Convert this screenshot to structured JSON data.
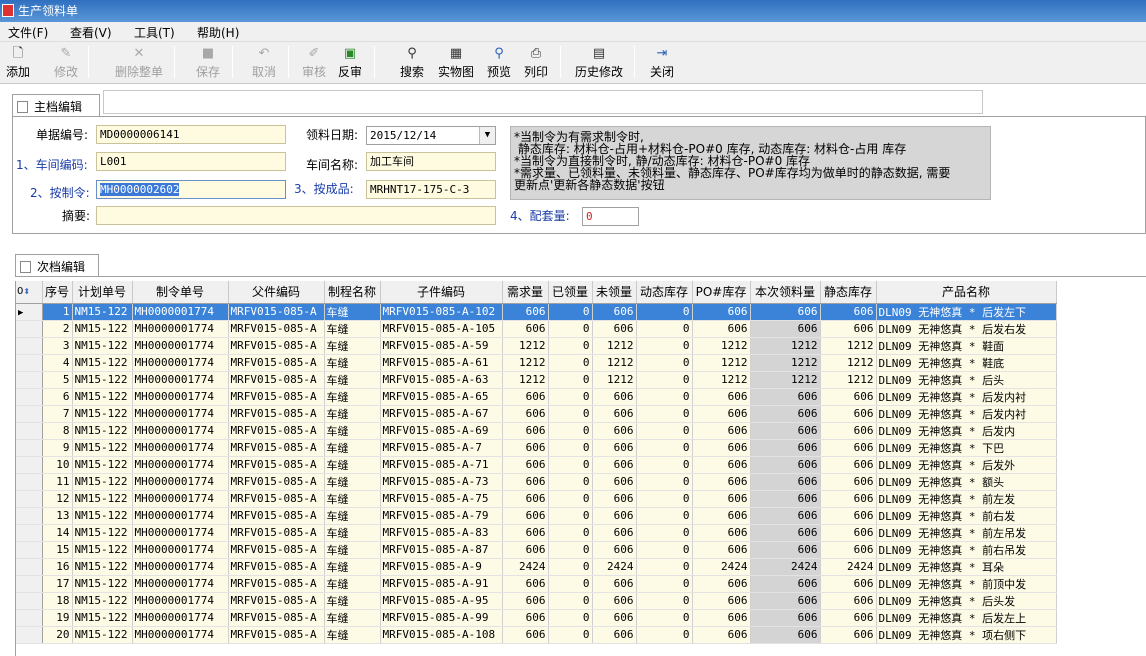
{
  "window": {
    "title": "生产领料单"
  },
  "menu": {
    "file": "文件(F)",
    "view": "查看(V)",
    "tools": "工具(T)",
    "help": "帮助(H)"
  },
  "toolbar": {
    "add": "添加",
    "edit": "修改",
    "delete_all": "删除整单",
    "save": "保存",
    "cancel": "取消",
    "audit": "审核",
    "reverse_audit": "反审",
    "search": "搜索",
    "physical_view": "实物图",
    "preview": "预览",
    "print": "列印",
    "history_edit": "历史修改",
    "close": "关闭"
  },
  "master": {
    "tab": "主档编辑",
    "doc_no_label": "单据编号:",
    "doc_no": "MD0000006141",
    "date_label": "领料日期:",
    "date": "2015/12/14",
    "workshop_code_label": "1、车间编码:",
    "workshop_code": "L001",
    "workshop_name_label": "车间名称:",
    "workshop_name": "加工车间",
    "order_label": "2、按制令:",
    "order": "MH0000002602",
    "product_label": "3、按成品:",
    "product": "MRHNT17-175-C-3",
    "remark_label": "摘要:",
    "remark": "",
    "sets_label": "4、配套量:",
    "sets": "0",
    "note": "*当制令为有需求制令时,\n 静态库存: 材料仓-占用+材料仓-PO#0 库存, 动态库存: 材料仓-占用 库存\n*当制令为直接制令时, 静/动态库存: 材料仓-PO#0 库存\n*需求量、已领料量、未领料量、静态库存、PO#库存均为做单时的静态数据, 需要\n更新点'更新各静态数据'按钮"
  },
  "detail": {
    "tab": "次档编辑",
    "corner": "0",
    "columns": [
      "序号",
      "计划单号",
      "制令单号",
      "父件编码",
      "制程名称",
      "子件编码",
      "需求量",
      "已领量",
      "未领量",
      "动态库存",
      "PO#库存",
      "本次领料量",
      "静态库存",
      "产品名称"
    ],
    "rows": [
      [
        "1",
        "NM15-122",
        "MH0000001774",
        "MRFV015-085-A",
        "车缝",
        "MRFV015-085-A-102",
        "606",
        "0",
        "606",
        "0",
        "606",
        "606",
        "606",
        "DLN09 无神悠真  * 后发左下"
      ],
      [
        "2",
        "NM15-122",
        "MH0000001774",
        "MRFV015-085-A",
        "车缝",
        "MRFV015-085-A-105",
        "606",
        "0",
        "606",
        "0",
        "606",
        "606",
        "606",
        "DLN09 无神悠真  * 后发右发"
      ],
      [
        "3",
        "NM15-122",
        "MH0000001774",
        "MRFV015-085-A",
        "车缝",
        "MRFV015-085-A-59",
        "1212",
        "0",
        "1212",
        "0",
        "1212",
        "1212",
        "1212",
        "DLN09 无神悠真  * 鞋面"
      ],
      [
        "4",
        "NM15-122",
        "MH0000001774",
        "MRFV015-085-A",
        "车缝",
        "MRFV015-085-A-61",
        "1212",
        "0",
        "1212",
        "0",
        "1212",
        "1212",
        "1212",
        "DLN09 无神悠真  * 鞋底"
      ],
      [
        "5",
        "NM15-122",
        "MH0000001774",
        "MRFV015-085-A",
        "车缝",
        "MRFV015-085-A-63",
        "1212",
        "0",
        "1212",
        "0",
        "1212",
        "1212",
        "1212",
        "DLN09 无神悠真  * 后头"
      ],
      [
        "6",
        "NM15-122",
        "MH0000001774",
        "MRFV015-085-A",
        "车缝",
        "MRFV015-085-A-65",
        "606",
        "0",
        "606",
        "0",
        "606",
        "606",
        "606",
        "DLN09 无神悠真  * 后发内衬"
      ],
      [
        "7",
        "NM15-122",
        "MH0000001774",
        "MRFV015-085-A",
        "车缝",
        "MRFV015-085-A-67",
        "606",
        "0",
        "606",
        "0",
        "606",
        "606",
        "606",
        "DLN09 无神悠真  * 后发内衬"
      ],
      [
        "8",
        "NM15-122",
        "MH0000001774",
        "MRFV015-085-A",
        "车缝",
        "MRFV015-085-A-69",
        "606",
        "0",
        "606",
        "0",
        "606",
        "606",
        "606",
        "DLN09 无神悠真  * 后发内"
      ],
      [
        "9",
        "NM15-122",
        "MH0000001774",
        "MRFV015-085-A",
        "车缝",
        "MRFV015-085-A-7",
        "606",
        "0",
        "606",
        "0",
        "606",
        "606",
        "606",
        "DLN09 无神悠真  * 下巴"
      ],
      [
        "10",
        "NM15-122",
        "MH0000001774",
        "MRFV015-085-A",
        "车缝",
        "MRFV015-085-A-71",
        "606",
        "0",
        "606",
        "0",
        "606",
        "606",
        "606",
        "DLN09 无神悠真  * 后发外"
      ],
      [
        "11",
        "NM15-122",
        "MH0000001774",
        "MRFV015-085-A",
        "车缝",
        "MRFV015-085-A-73",
        "606",
        "0",
        "606",
        "0",
        "606",
        "606",
        "606",
        "DLN09 无神悠真  * 额头"
      ],
      [
        "12",
        "NM15-122",
        "MH0000001774",
        "MRFV015-085-A",
        "车缝",
        "MRFV015-085-A-75",
        "606",
        "0",
        "606",
        "0",
        "606",
        "606",
        "606",
        "DLN09 无神悠真  * 前左发"
      ],
      [
        "13",
        "NM15-122",
        "MH0000001774",
        "MRFV015-085-A",
        "车缝",
        "MRFV015-085-A-79",
        "606",
        "0",
        "606",
        "0",
        "606",
        "606",
        "606",
        "DLN09 无神悠真  * 前右发"
      ],
      [
        "14",
        "NM15-122",
        "MH0000001774",
        "MRFV015-085-A",
        "车缝",
        "MRFV015-085-A-83",
        "606",
        "0",
        "606",
        "0",
        "606",
        "606",
        "606",
        "DLN09 无神悠真  * 前左吊发"
      ],
      [
        "15",
        "NM15-122",
        "MH0000001774",
        "MRFV015-085-A",
        "车缝",
        "MRFV015-085-A-87",
        "606",
        "0",
        "606",
        "0",
        "606",
        "606",
        "606",
        "DLN09 无神悠真  * 前右吊发"
      ],
      [
        "16",
        "NM15-122",
        "MH0000001774",
        "MRFV015-085-A",
        "车缝",
        "MRFV015-085-A-9",
        "2424",
        "0",
        "2424",
        "0",
        "2424",
        "2424",
        "2424",
        "DLN09 无神悠真  * 耳朵"
      ],
      [
        "17",
        "NM15-122",
        "MH0000001774",
        "MRFV015-085-A",
        "车缝",
        "MRFV015-085-A-91",
        "606",
        "0",
        "606",
        "0",
        "606",
        "606",
        "606",
        "DLN09 无神悠真  * 前顶中发"
      ],
      [
        "18",
        "NM15-122",
        "MH0000001774",
        "MRFV015-085-A",
        "车缝",
        "MRFV015-085-A-95",
        "606",
        "0",
        "606",
        "0",
        "606",
        "606",
        "606",
        "DLN09 无神悠真  * 后头发"
      ],
      [
        "19",
        "NM15-122",
        "MH0000001774",
        "MRFV015-085-A",
        "车缝",
        "MRFV015-085-A-99",
        "606",
        "0",
        "606",
        "0",
        "606",
        "606",
        "606",
        "DLN09 无神悠真  * 后发左上"
      ],
      [
        "20",
        "NM15-122",
        "MH0000001774",
        "MRFV015-085-A",
        "车缝",
        "MRFV015-085-A-108",
        "606",
        "0",
        "606",
        "0",
        "606",
        "606",
        "606",
        "DLN09 无神悠真  * 项右侧下"
      ]
    ]
  }
}
